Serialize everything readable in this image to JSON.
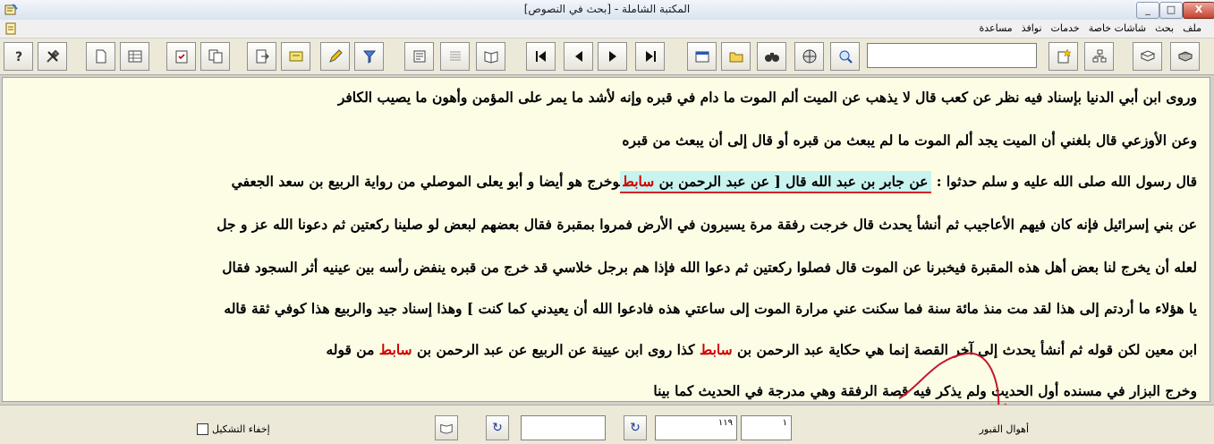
{
  "window": {
    "title": "المكتبة الشاملة - [بحث في النصوص]",
    "minimize": "_",
    "maximize": "□",
    "close": "X"
  },
  "menu": {
    "items": [
      "ملف",
      "بحث",
      "شاشات خاصة",
      "خدمات",
      "نوافذ",
      "مساعدة"
    ]
  },
  "toolbar": {
    "search_value": "",
    "icons": [
      "help-icon",
      "tools-icon",
      "new-page-icon",
      "grid-icon",
      "clipboard-icon",
      "copy-icon",
      "export-icon",
      "card-icon",
      "pen-icon",
      "filter-icon",
      "properties-icon",
      "list-icon",
      "book-open-icon",
      "first-icon",
      "prev-icon",
      "next-icon",
      "last-icon",
      "window-icon",
      "folder-icon",
      "binoculars-icon",
      "globe-icon",
      "search-web-icon",
      "star-page-icon",
      "tree-icon",
      "book-icon",
      "book-closed-icon"
    ]
  },
  "content": {
    "lines": [
      [
        {
          "t": "وروى ابن أبي الدنيا بإسناد فيه نظر عن كعب قال لا يذهب عن الميت ألم الموت ما دام في قبره وإنه لأشد ما يمر على المؤمن وأهون ما يصيب الكافر",
          "s": "n"
        }
      ],
      [
        {
          "t": "وعن الأوزعي قال بلغني أن الميت يجد ألم الموت ما لم يبعث من قبره أو قال إلى أن يبعث من قبره",
          "s": "n"
        }
      ],
      [
        {
          "t": "قال رسول الله صلى الله عليه و سلم حدثوا",
          "s": "n"
        },
        {
          "t": " : ",
          "s": "n"
        },
        {
          "t": "عن جابر بن عبد الله قال",
          "s": "h"
        },
        {
          "t": " [ ",
          "s": "h"
        },
        {
          "t": "سابط",
          "s": "hr"
        },
        {
          "t": "عن عبد الرحمن بن ",
          "s": "h"
        },
        {
          "t": "وخرج هو أيضا و أبو يعلى الموصلي من رواية الربيع بن سعد الجعفي ",
          "s": "n"
        }
      ],
      [
        {
          "t": "عن بني إسرائيل فإنه كان فيهم الأعاجيب ثم أنشأ يحدث قال خرجت رفقة مرة يسيرون في الأرض فمروا بمقبرة فقال بعضهم لبعض لو صلينا ركعتين ثم دعونا الله عز و جل",
          "s": "n"
        }
      ],
      [
        {
          "t": "لعله أن يخرج لنا بعض أهل هذه المقبرة فيخبرنا عن الموت قال فصلوا ركعتين ثم دعوا الله فإذا هم برجل خلاسي قد خرج من قبره ينفض رأسه بين عينيه أثر السجود فقال",
          "s": "n"
        }
      ],
      [
        {
          "t": "يا هؤلاء ما أردتم إلى هذا لقد مت منذ مائة سنة فما سكنت عني مرارة الموت إلى ساعتي هذه فادعوا الله أن يعيدني كما كنت ] وهذا إسناد جيد والربيع هذا كوفي ثقة قاله",
          "s": "n"
        }
      ],
      [
        {
          "t": "ابن معين لكن قوله ثم أنشأ يحدث إلى آخر القصة إنما هي حكاية عبد الرحمن بن ",
          "s": "n"
        },
        {
          "t": "سابط",
          "s": "r"
        },
        {
          "t": " كذا روى ابن عيينة عن الربيع عن عبد الرحمن بن ",
          "s": "n"
        },
        {
          "t": "سابط",
          "s": "r"
        },
        {
          "t": " من قوله",
          "s": "n"
        }
      ],
      [
        {
          "t": "وخرج البزار في مسنده أول الحديث ولم يذكر فيه قصة الرفقة وهي مدرجة في الحديث كما بينا",
          "s": "n"
        }
      ]
    ]
  },
  "status": {
    "section": "أهوال القبور",
    "page": "١",
    "volume": "١١٩",
    "hide_diacritics_label": "إخفاء التشكيل",
    "hide_diacritics_checked": false,
    "refresh_icon": "↻"
  }
}
